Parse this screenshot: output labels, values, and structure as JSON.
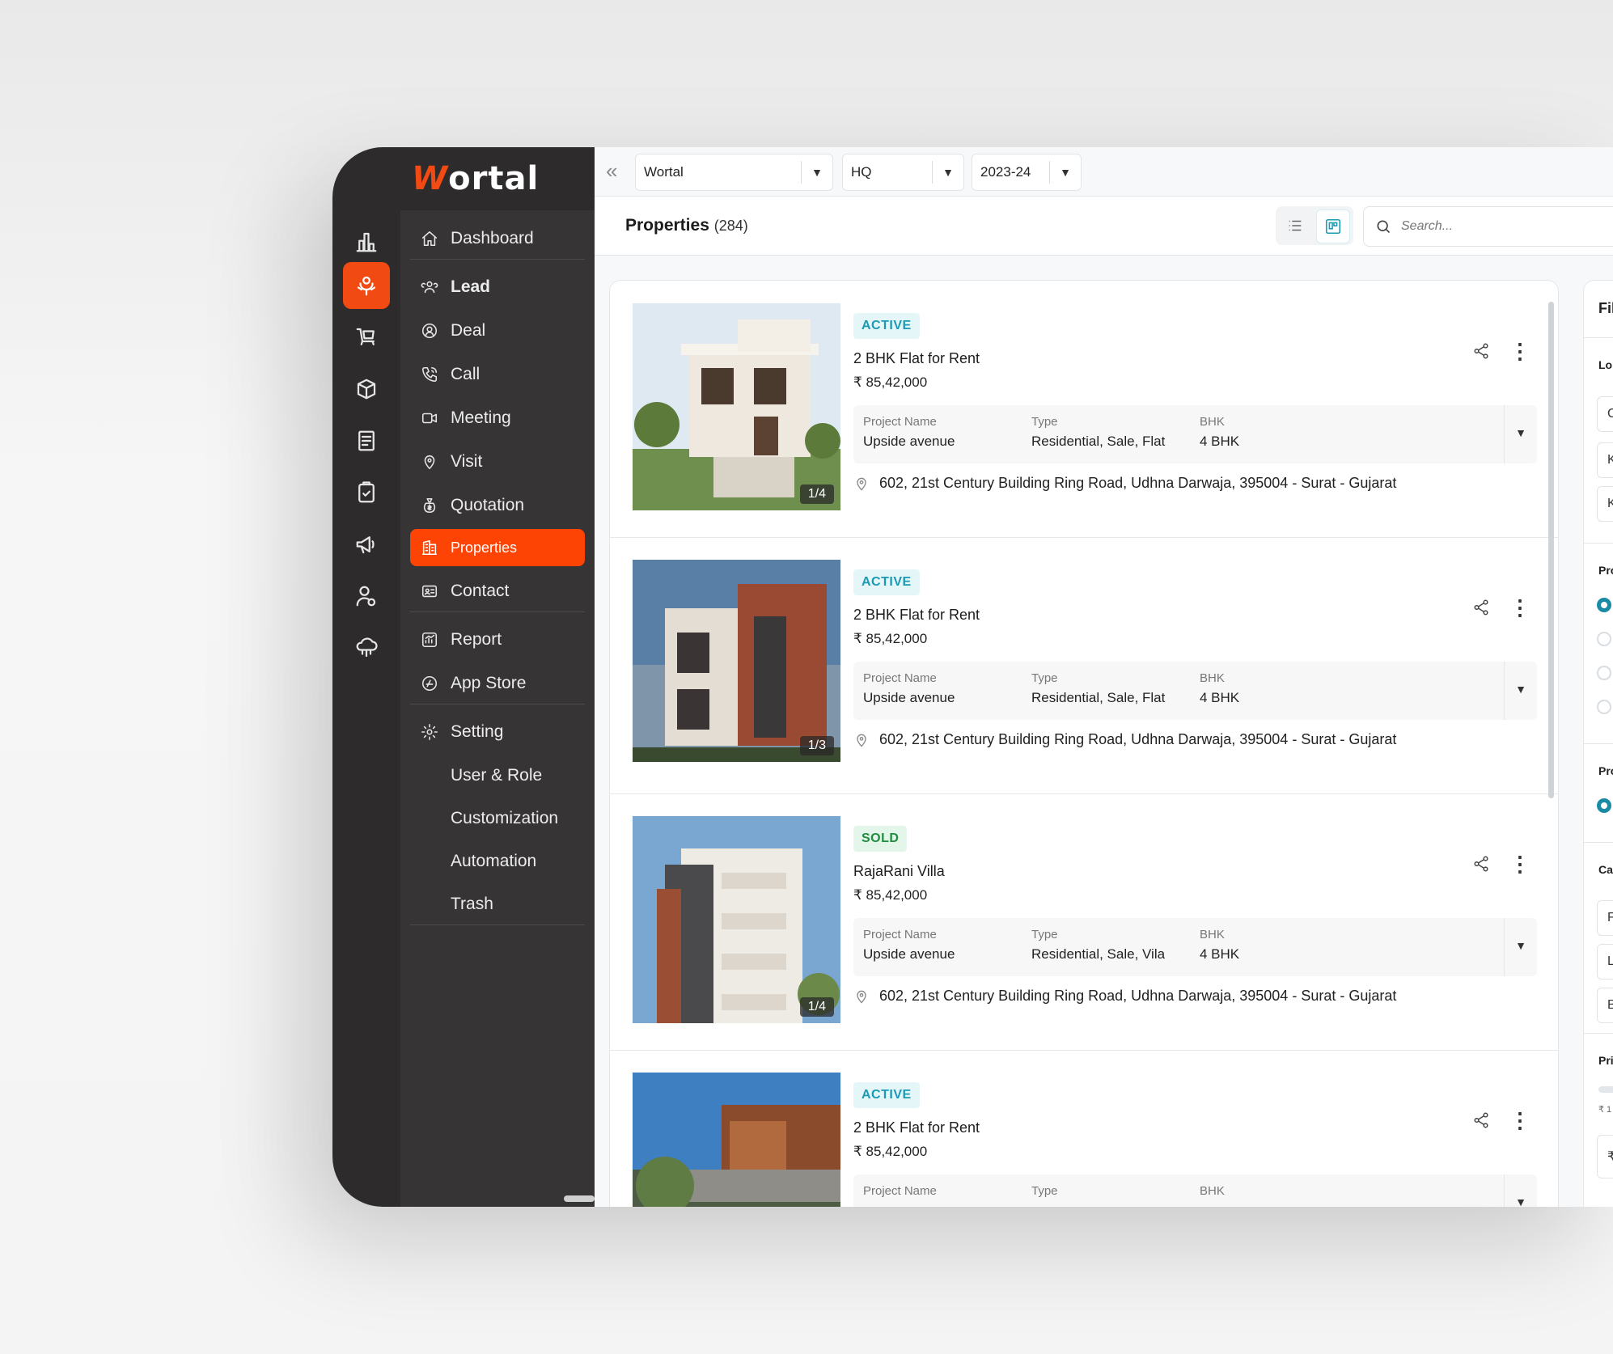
{
  "brand": {
    "logo_first": "W",
    "logo_rest": "ortal"
  },
  "rail": [
    "bar-chart-icon",
    "lead-icon",
    "cart-icon",
    "cube-icon",
    "document-icon",
    "clipboard-icon",
    "megaphone-icon",
    "user-gear-icon",
    "cloud-icon"
  ],
  "menu": {
    "items": [
      {
        "label": "Dashboard",
        "icon": "home-icon"
      },
      {
        "label": "Lead",
        "icon": "users-icon"
      },
      {
        "label": "Deal",
        "icon": "deal-icon"
      },
      {
        "label": "Call",
        "icon": "phone-icon"
      },
      {
        "label": "Meeting",
        "icon": "video-icon"
      },
      {
        "label": "Visit",
        "icon": "location-icon"
      },
      {
        "label": "Quotation",
        "icon": "money-bag-icon"
      },
      {
        "label": "Properties",
        "icon": "building-icon"
      },
      {
        "label": "Contact",
        "icon": "contact-card-icon"
      },
      {
        "label": "Report",
        "icon": "report-icon"
      },
      {
        "label": "App Store",
        "icon": "app-store-icon"
      },
      {
        "label": "Setting",
        "icon": "gear-icon"
      },
      {
        "label": "User & Role"
      },
      {
        "label": "Customization"
      },
      {
        "label": "Automation"
      },
      {
        "label": "Trash"
      }
    ]
  },
  "topbar": {
    "company": "Wortal",
    "branch": "HQ",
    "year": "2023-24"
  },
  "header": {
    "title": "Properties",
    "count": "(284)",
    "search_placeholder": "Search..."
  },
  "labels": {
    "project_name": "Project Name",
    "type": "Type",
    "bhk": "BHK"
  },
  "properties": [
    {
      "status": "ACTIVE",
      "title": "2 BHK Flat for Rent",
      "price": "₹ 85,42,000",
      "project": "Upside avenue",
      "type": "Residential, Sale, Flat",
      "bhk": "4 BHK",
      "address": "602, 21st Century Building Ring Road, Udhna Darwaja, 395004 - Surat - Gujarat",
      "counter": "1/4"
    },
    {
      "status": "ACTIVE",
      "title": "2 BHK Flat for Rent",
      "price": "₹ 85,42,000",
      "project": "Upside avenue",
      "type": "Residential, Sale, Flat",
      "bhk": "4 BHK",
      "address": "602, 21st Century Building Ring Road, Udhna Darwaja, 395004 - Surat - Gujarat",
      "counter": "1/3"
    },
    {
      "status": "SOLD",
      "title": "RajaRani Villa",
      "price": "₹ 85,42,000",
      "project": "Upside avenue",
      "type": "Residential, Sale, Vila",
      "bhk": "4 BHK",
      "address": "602, 21st Century Building Ring Road, Udhna Darwaja, 395004 - Surat - Gujarat",
      "counter": "1/4"
    },
    {
      "status": "ACTIVE",
      "title": "2 BHK Flat for Rent",
      "price": "₹ 85,42,000"
    }
  ],
  "filters": {
    "title": "Fil",
    "loc": "Lo",
    "loc_inputs": [
      "C",
      "K",
      "K"
    ],
    "pro1": "Pro",
    "pro2": "Pro",
    "cat": "Ca",
    "cat_inputs": [
      "F",
      "L",
      "B"
    ],
    "pri": "Pri",
    "pri_min": "₹ 1",
    "pri_input": "₹"
  },
  "colors": {
    "accent": "#fe4404",
    "teal": "#1b9ab3",
    "sold": "#1e8e3e"
  }
}
